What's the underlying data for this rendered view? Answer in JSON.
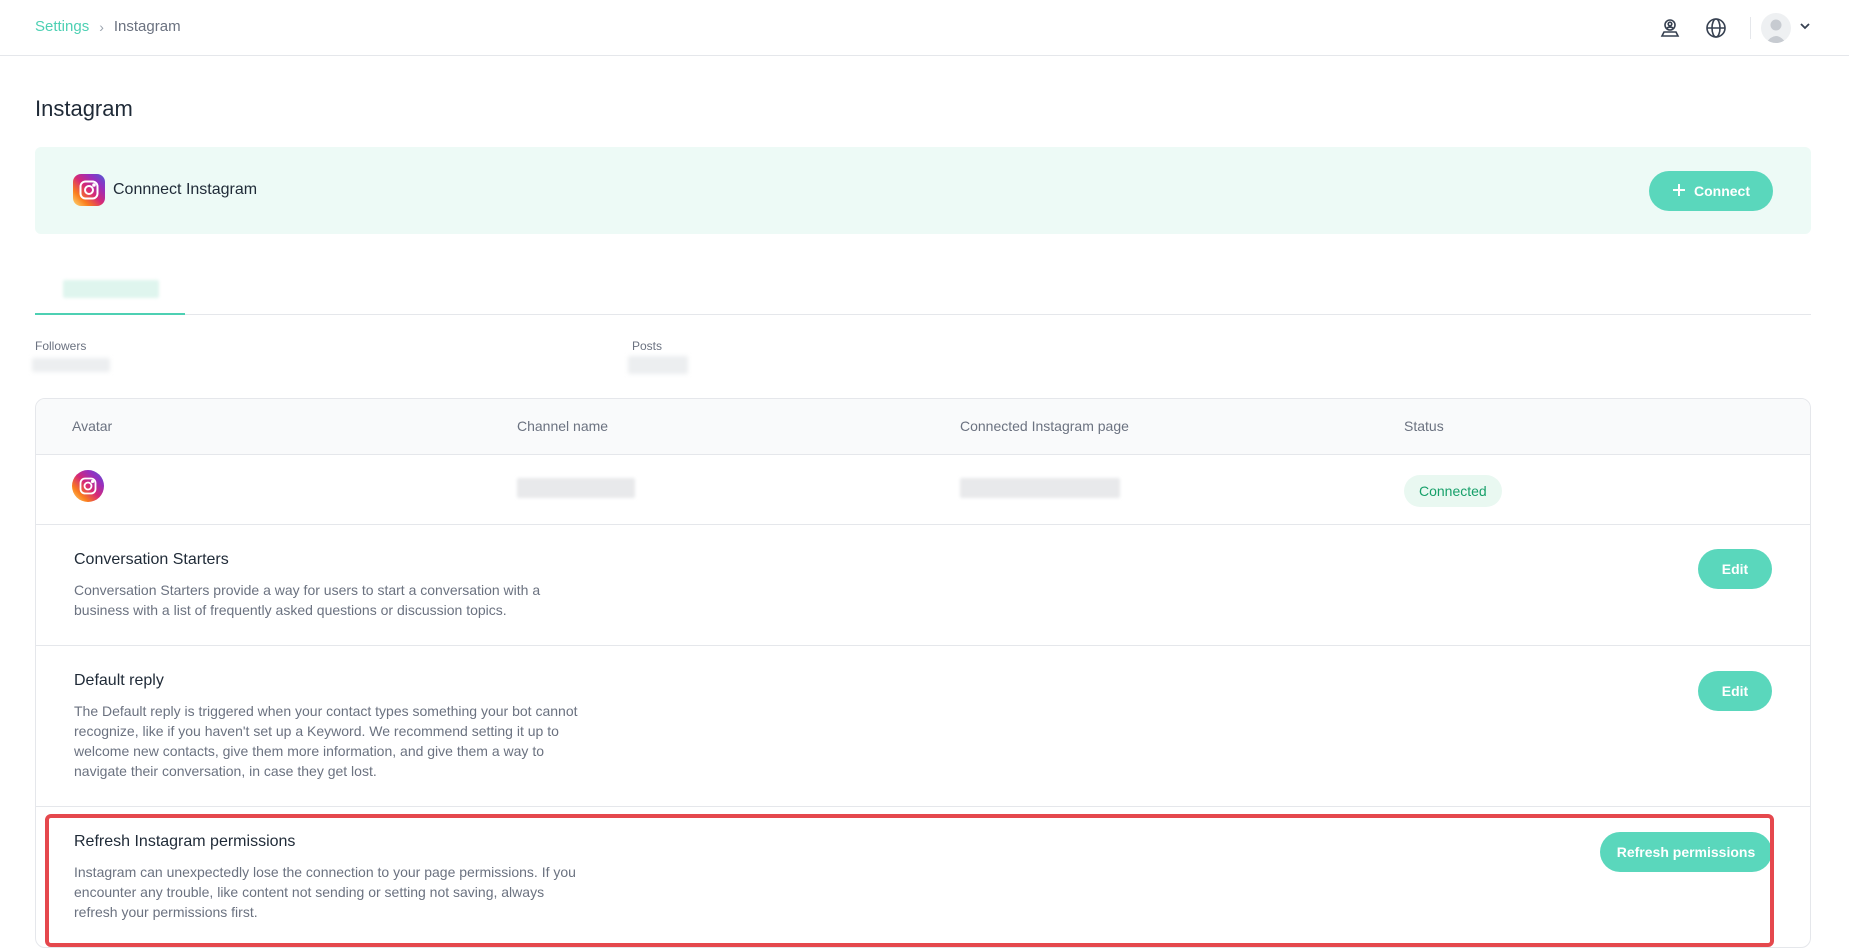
{
  "breadcrumb": {
    "parent": "Settings",
    "separator": "›",
    "current": "Instagram"
  },
  "header_icons": [
    "user-location-icon",
    "globe-icon",
    "avatar-icon",
    "chevron-down-icon"
  ],
  "page": {
    "title": "Instagram"
  },
  "connect": {
    "label": "Connnect Instagram",
    "button": "Connect",
    "button_icon": "plus-icon"
  },
  "stats": {
    "followers_label": "Followers",
    "posts_label": "Posts"
  },
  "table": {
    "headers": [
      "Avatar",
      "Channel name",
      "Connected Instagram page",
      "Status"
    ],
    "row": {
      "status": "Connected"
    }
  },
  "sections": [
    {
      "title": "Conversation Starters",
      "description": "Conversation Starters provide a way for users to start a conversation with a business with a list of frequently asked questions or discussion topics.",
      "button": "Edit"
    },
    {
      "title": "Default reply",
      "description": "The Default reply is triggered when your contact types something your bot cannot recognize, like if you haven't set up a Keyword. We recommend setting it up to welcome new contacts, give them more information, and give them a way to navigate their conversation, in case they get lost.",
      "button": "Edit"
    },
    {
      "title": "Refresh Instagram permissions",
      "description": "Instagram can unexpectedly lose the connection to your page permissions. If you encounter any trouble, like content not sending or setting not saving, always refresh your permissions first.",
      "button": "Refresh permissions"
    }
  ],
  "colors": {
    "accent": "#5ad7bc",
    "banner_bg": "#edfaf6",
    "status_green": "#17a06a",
    "highlight": "#e5484d"
  }
}
